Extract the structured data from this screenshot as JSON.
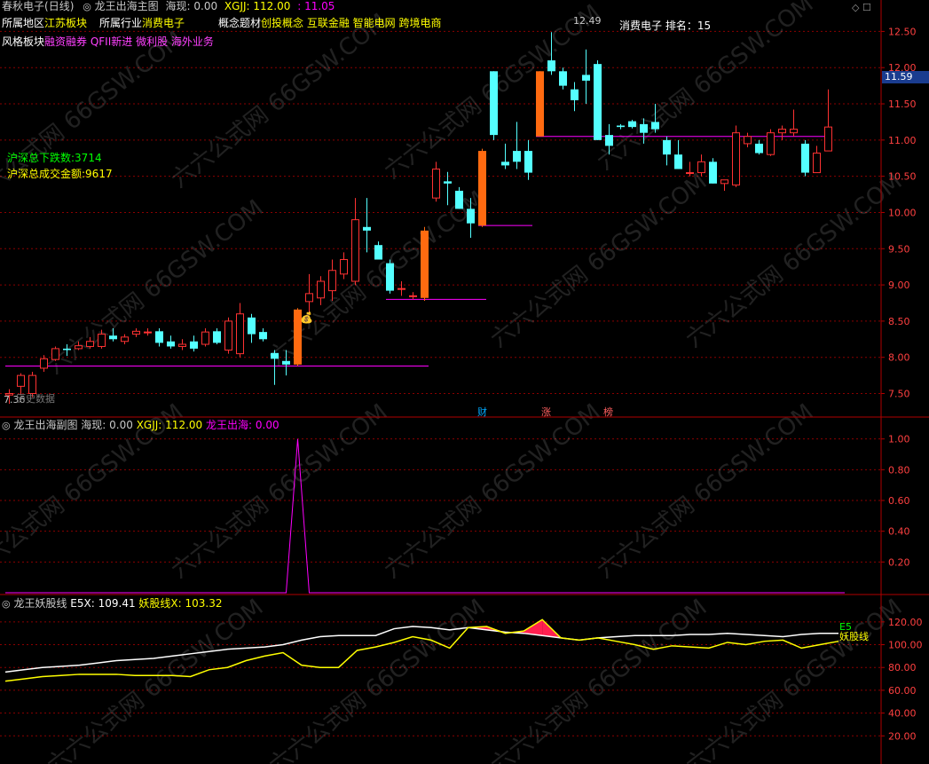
{
  "main_panel": {
    "stock_name": "春秋电子",
    "period": "(日线)",
    "indicator": "龙王出海主图",
    "haixian_label": "海现:",
    "haixian_value": "0.00",
    "xgjj_label": "XGJJ:",
    "xgjj_value": "112.00",
    "price_value": "11.05",
    "region_label": "所属地区",
    "region_value": "江苏板块",
    "industry_label": "所属行业",
    "industry_value": "消费电子",
    "concept_label": "概念题材",
    "concept_value": "创投概念 互联金融 智能电网 跨境电商",
    "style_label": "风格板块",
    "style_value": "融资融券 QFII新进 微利股 海外业务",
    "rank_label": "消费电子 排名：",
    "rank_value": "15",
    "down_count_label": "沪深总下跌数:",
    "down_count_value": "3714",
    "turnover_label": "沪深总成交金额:",
    "turnover_value": "9617",
    "max_label": "12.49",
    "min_label": "7.36",
    "bottom_note": "历史数据",
    "current_price_tag": "11.59",
    "markers": [
      "财",
      "涨",
      "榜"
    ],
    "axis_ticks": [
      "12.50",
      "12.00",
      "11.50",
      "11.00",
      "10.50",
      "10.00",
      "9.50",
      "9.00",
      "8.50",
      "8.00",
      "7.50"
    ]
  },
  "sub_panel": {
    "indicator": "龙王出海副图",
    "haixian_label": "海现:",
    "haixian_value": "0.00",
    "xgjj_label": "XGJJ:",
    "xgjj_value": "112.00",
    "dragon_label": "龙王出海:",
    "dragon_value": "0.00",
    "axis_ticks": [
      "1.00",
      "0.80",
      "0.60",
      "0.40",
      "0.20"
    ]
  },
  "third_panel": {
    "indicator": "龙王妖股线",
    "e5_label": "E5X:",
    "e5_value": "109.41",
    "yao_label": "妖股线X:",
    "yao_value": "103.32",
    "e5_tag": "E5",
    "yao_tag": "妖股线",
    "axis_ticks": [
      "120.00",
      "100.00",
      "80.00",
      "60.00",
      "40.00",
      "20.00"
    ]
  },
  "watermark": "六六公式网 66GSW.COM",
  "colors": {
    "up": "#ff3232",
    "down": "#54ffff",
    "signal": "#ff6a10",
    "magenta": "#ff00ff",
    "grid": "#8b0000",
    "axis": "#b00000",
    "white_line": "#ffffff",
    "yellow_line": "#ffff00"
  },
  "chart_data": [
    {
      "type": "candlestick",
      "title": "龙王出海主图",
      "ylim": [
        7.2,
        12.75
      ],
      "candles": [
        {
          "o": 7.48,
          "h": 7.56,
          "l": 7.36,
          "c": 7.5
        },
        {
          "o": 7.6,
          "h": 7.78,
          "l": 7.48,
          "c": 7.75
        },
        {
          "o": 7.5,
          "h": 7.8,
          "l": 7.45,
          "c": 7.75
        },
        {
          "o": 7.85,
          "h": 8.03,
          "l": 7.8,
          "c": 7.98
        },
        {
          "o": 7.97,
          "h": 8.15,
          "l": 7.95,
          "c": 8.12
        },
        {
          "o": 8.12,
          "h": 8.18,
          "l": 8.02,
          "c": 8.1
        },
        {
          "o": 8.12,
          "h": 8.22,
          "l": 8.1,
          "c": 8.16
        },
        {
          "o": 8.15,
          "h": 8.28,
          "l": 8.12,
          "c": 8.22
        },
        {
          "o": 8.15,
          "h": 8.38,
          "l": 8.12,
          "c": 8.32
        },
        {
          "o": 8.3,
          "h": 8.4,
          "l": 8.22,
          "c": 8.25
        },
        {
          "o": 8.22,
          "h": 8.32,
          "l": 8.18,
          "c": 8.28
        },
        {
          "o": 8.32,
          "h": 8.4,
          "l": 8.28,
          "c": 8.36
        },
        {
          "o": 8.35,
          "h": 8.4,
          "l": 8.3,
          "c": 8.35
        },
        {
          "o": 8.36,
          "h": 8.4,
          "l": 8.15,
          "c": 8.2
        },
        {
          "o": 8.22,
          "h": 8.3,
          "l": 8.12,
          "c": 8.15
        },
        {
          "o": 8.15,
          "h": 8.25,
          "l": 8.1,
          "c": 8.18
        },
        {
          "o": 8.22,
          "h": 8.3,
          "l": 8.08,
          "c": 8.12
        },
        {
          "o": 8.18,
          "h": 8.4,
          "l": 8.15,
          "c": 8.35
        },
        {
          "o": 8.36,
          "h": 8.4,
          "l": 8.18,
          "c": 8.2
        },
        {
          "o": 8.1,
          "h": 8.55,
          "l": 8.05,
          "c": 8.5
        },
        {
          "o": 8.05,
          "h": 8.75,
          "l": 8.0,
          "c": 8.6
        },
        {
          "o": 8.55,
          "h": 8.6,
          "l": 8.2,
          "c": 8.32
        },
        {
          "o": 8.35,
          "h": 8.4,
          "l": 8.22,
          "c": 8.25
        },
        {
          "o": 8.06,
          "h": 8.1,
          "l": 7.62,
          "c": 7.98
        },
        {
          "o": 7.95,
          "h": 8.1,
          "l": 7.75,
          "c": 7.9
        },
        {
          "o": 7.9,
          "h": 8.68,
          "l": 7.88,
          "c": 8.66,
          "signal": true
        },
        {
          "o": 8.77,
          "h": 9.15,
          "l": 8.62,
          "c": 8.88
        },
        {
          "o": 8.82,
          "h": 9.12,
          "l": 8.72,
          "c": 9.05
        },
        {
          "o": 8.92,
          "h": 9.35,
          "l": 8.78,
          "c": 9.2
        },
        {
          "o": 9.15,
          "h": 9.45,
          "l": 9.08,
          "c": 9.35
        },
        {
          "o": 9.05,
          "h": 10.2,
          "l": 9.0,
          "c": 9.9
        },
        {
          "o": 9.8,
          "h": 10.2,
          "l": 9.45,
          "c": 9.75
        },
        {
          "o": 9.55,
          "h": 9.6,
          "l": 9.35,
          "c": 9.35
        },
        {
          "o": 9.3,
          "h": 9.35,
          "l": 8.88,
          "c": 8.92
        },
        {
          "o": 8.95,
          "h": 9.05,
          "l": 8.85,
          "c": 8.95
        },
        {
          "o": 8.85,
          "h": 8.9,
          "l": 8.8,
          "c": 8.85
        },
        {
          "o": 8.82,
          "h": 9.8,
          "l": 8.78,
          "c": 9.75,
          "signal": true
        },
        {
          "o": 10.2,
          "h": 10.7,
          "l": 10.15,
          "c": 10.6
        },
        {
          "o": 10.43,
          "h": 10.56,
          "l": 10.1,
          "c": 10.4
        },
        {
          "o": 10.3,
          "h": 10.35,
          "l": 10.05,
          "c": 10.05
        },
        {
          "o": 10.05,
          "h": 10.2,
          "l": 9.65,
          "c": 9.85
        },
        {
          "o": 9.82,
          "h": 10.88,
          "l": 9.8,
          "c": 10.85,
          "signal": true
        },
        {
          "o": 11.95,
          "h": 11.95,
          "l": 11.0,
          "c": 11.07
        },
        {
          "o": 10.7,
          "h": 10.95,
          "l": 10.6,
          "c": 10.65
        },
        {
          "o": 10.85,
          "h": 11.25,
          "l": 10.6,
          "c": 10.7
        },
        {
          "o": 10.85,
          "h": 11.0,
          "l": 10.45,
          "c": 10.55
        },
        {
          "o": 11.05,
          "h": 11.95,
          "l": 11.05,
          "c": 11.95,
          "signal": true
        },
        {
          "o": 12.1,
          "h": 12.49,
          "l": 11.9,
          "c": 11.95
        },
        {
          "o": 11.95,
          "h": 12.0,
          "l": 11.7,
          "c": 11.75
        },
        {
          "o": 11.7,
          "h": 11.8,
          "l": 11.4,
          "c": 11.55
        },
        {
          "o": 11.9,
          "h": 12.25,
          "l": 11.5,
          "c": 11.82
        },
        {
          "o": 12.05,
          "h": 12.1,
          "l": 11.0,
          "c": 11.0
        },
        {
          "o": 11.07,
          "h": 11.22,
          "l": 10.8,
          "c": 10.92
        },
        {
          "o": 11.2,
          "h": 11.22,
          "l": 11.15,
          "c": 11.18
        },
        {
          "o": 11.26,
          "h": 11.28,
          "l": 11.16,
          "c": 11.18
        },
        {
          "o": 11.22,
          "h": 11.3,
          "l": 10.95,
          "c": 11.1
        },
        {
          "o": 11.25,
          "h": 11.5,
          "l": 11.1,
          "c": 11.15
        },
        {
          "o": 11.0,
          "h": 11.05,
          "l": 10.65,
          "c": 10.8
        },
        {
          "o": 10.8,
          "h": 11.0,
          "l": 10.6,
          "c": 10.6
        },
        {
          "o": 10.55,
          "h": 10.7,
          "l": 10.5,
          "c": 10.55
        },
        {
          "o": 10.55,
          "h": 10.8,
          "l": 10.5,
          "c": 10.7
        },
        {
          "o": 10.7,
          "h": 10.75,
          "l": 10.4,
          "c": 10.4
        },
        {
          "o": 10.4,
          "h": 10.45,
          "l": 10.3,
          "c": 10.45
        },
        {
          "o": 10.38,
          "h": 11.2,
          "l": 10.35,
          "c": 11.1
        },
        {
          "o": 10.95,
          "h": 11.1,
          "l": 10.9,
          "c": 11.05
        },
        {
          "o": 10.95,
          "h": 11.0,
          "l": 10.8,
          "c": 10.82
        },
        {
          "o": 10.8,
          "h": 11.15,
          "l": 10.78,
          "c": 11.1
        },
        {
          "o": 11.1,
          "h": 11.2,
          "l": 11.0,
          "c": 11.15
        },
        {
          "o": 11.1,
          "h": 11.42,
          "l": 11.05,
          "c": 11.15
        },
        {
          "o": 10.95,
          "h": 11.0,
          "l": 10.5,
          "c": 10.55
        },
        {
          "o": 10.55,
          "h": 10.92,
          "l": 10.55,
          "c": 10.82
        },
        {
          "o": 10.85,
          "h": 11.7,
          "l": 10.85,
          "c": 11.18
        }
      ],
      "support_lines": [
        {
          "from": 0,
          "to": 36,
          "y": 7.88
        },
        {
          "from": 33,
          "to": 41,
          "y": 8.8
        },
        {
          "from": 41,
          "to": 45,
          "y": 9.82
        },
        {
          "from": 46,
          "to": 71,
          "y": 11.05
        }
      ]
    },
    {
      "type": "line",
      "title": "龙王出海副图",
      "ylim": [
        0,
        1.05
      ],
      "series": [
        {
          "name": "龙王出海",
          "spike_index": 25,
          "spike_value": 1.0,
          "baseline": 0
        }
      ]
    },
    {
      "type": "line",
      "title": "龙王妖股线",
      "ylim": [
        0,
        130
      ],
      "series": [
        {
          "name": "E5",
          "values": [
            76,
            78,
            80,
            81,
            82,
            84,
            86,
            87,
            88,
            90,
            92,
            94,
            96,
            97,
            98,
            100,
            104,
            107,
            108,
            108,
            108,
            114,
            116,
            115,
            113,
            115,
            113,
            111,
            110,
            108,
            106,
            104,
            106,
            107,
            108,
            108,
            108,
            109,
            109,
            110,
            109,
            108,
            107,
            109,
            110,
            110
          ]
        },
        {
          "name": "妖股线",
          "values": [
            68,
            70,
            72,
            73,
            74,
            74,
            74,
            73,
            73,
            73,
            72,
            78,
            80,
            86,
            90,
            93,
            82,
            80,
            80,
            95,
            98,
            102,
            107,
            104,
            97,
            115,
            116,
            110,
            112,
            122,
            106,
            104,
            106,
            103,
            100,
            96,
            99,
            98,
            97,
            102,
            100,
            103,
            104,
            97,
            100,
            103
          ]
        }
      ]
    }
  ]
}
